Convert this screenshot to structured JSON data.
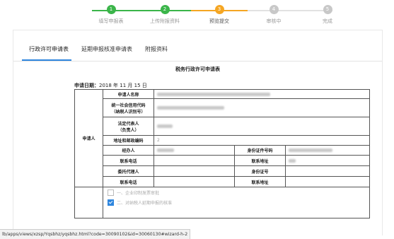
{
  "colors": {
    "done": "#3bb54a",
    "current": "#f5a623",
    "pending": "#c8c8c8",
    "accent": "#2e86de"
  },
  "wizard": {
    "steps": [
      {
        "num": "1",
        "label": "填写申报表",
        "state": "done"
      },
      {
        "num": "2",
        "label": "上传附报资料",
        "state": "done"
      },
      {
        "num": "3",
        "label": "预览提交",
        "state": "current"
      },
      {
        "num": "4",
        "label": "审核中",
        "state": "pending"
      },
      {
        "num": "5",
        "label": "完成",
        "state": "pending"
      }
    ]
  },
  "tabs": [
    "行政许可申请表",
    "延期申报核准申请表",
    "附报资料"
  ],
  "form": {
    "title": "税务行政许可申请表",
    "date_label": "申请日期：",
    "date_value": "2018 年 11 月 15 日",
    "group_label": "申请人",
    "fields": {
      "applicant_name": "申请人名称",
      "credit_code": "统一社会信用代码\n（纳税人识别号）",
      "legal_rep": "法定代表人\n（负责人）",
      "address": "地址和邮政编码",
      "address_value": "2",
      "handler": "经办人",
      "id_number": "身份证件号码",
      "phone": "联系电话",
      "contact_addr": "联系地址",
      "agent": "委托代理人",
      "id_no": "身份证号",
      "phone2": "联系电话",
      "contact_addr2": "联系地址"
    },
    "options": [
      {
        "label": "一、企业印制发票审批",
        "checked": false
      },
      {
        "label": "二、对纳税人延期申报的核准",
        "checked": true
      }
    ]
  },
  "status_url": "lb/apps/views/xzsp/Yqsbhz/yqsbhz.html?code=30090102&id=30060130#wizard-h-2"
}
